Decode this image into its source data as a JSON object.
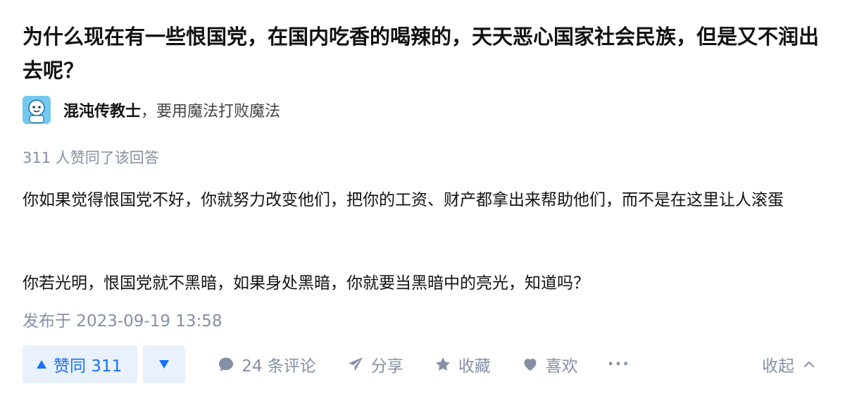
{
  "question": {
    "title": "为什么现在有一些恨国党，在国内吃香的喝辣的，天天恶心国家社会民族，但是又不润出去呢？"
  },
  "author": {
    "name": "混沌传教士",
    "separator": "，",
    "bio": "要用魔法打败魔法"
  },
  "answer": {
    "votes_info": "311 人赞同了该回答",
    "paragraphs": [
      "你如果觉得恨国党不好，你就努力改变他们，把你的工资、财产都拿出来帮助他们，而不是在这里让人滚蛋",
      "你若光明，恨国党就不黑暗，如果身处黑暗，你就要当黑暗中的亮光，知道吗？"
    ],
    "published": "发布于 2023-09-19 13:58"
  },
  "actions": {
    "upvote_label": "赞同 311",
    "comments_label": "24 条评论",
    "share_label": "分享",
    "favorite_label": "收藏",
    "like_label": "喜欢",
    "more_label": "···",
    "collapse_label": "收起"
  },
  "colors": {
    "accent": "#1772f6",
    "accent_bg": "#e9f1fc",
    "muted": "#8590a6"
  },
  "icons": {
    "upvote": "triangle-up-icon",
    "downvote": "triangle-down-icon",
    "comment": "comment-bubble-icon",
    "share": "paper-plane-icon",
    "favorite": "star-icon",
    "like": "heart-icon",
    "collapse": "chevron-up-icon"
  }
}
